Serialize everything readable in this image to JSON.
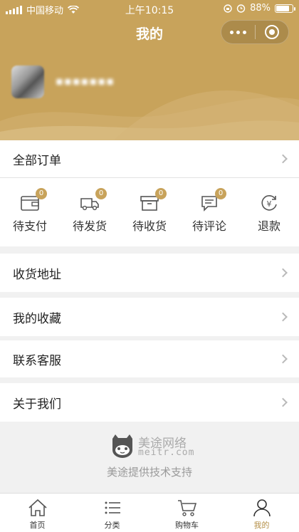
{
  "status_bar": {
    "carrier": "中国移动",
    "time": "上午10:15",
    "battery": "88%",
    "battery_level": 0.88
  },
  "nav": {
    "title": "我的"
  },
  "profile": {
    "username": "▪▪▪▪▪▪▪"
  },
  "orders": {
    "all_label": "全部订单",
    "items": [
      {
        "label": "待支付",
        "badge": "0",
        "icon": "wallet-icon"
      },
      {
        "label": "待发货",
        "badge": "0",
        "icon": "delivery-truck-icon"
      },
      {
        "label": "待收货",
        "badge": "0",
        "icon": "package-box-icon"
      },
      {
        "label": "待评论",
        "badge": "0",
        "icon": "comment-icon"
      },
      {
        "label": "退款",
        "badge": "",
        "icon": "yen-refund-icon"
      }
    ]
  },
  "menu": {
    "address": "收货地址",
    "favorites": "我的收藏",
    "contact": "联系客服",
    "about": "关于我们"
  },
  "brand": {
    "name": "美途网络",
    "url": "meitr.com",
    "support": "美途提供技术支持"
  },
  "tabbar": {
    "items": [
      {
        "label": "首页",
        "icon": "home-icon"
      },
      {
        "label": "分类",
        "icon": "list-icon"
      },
      {
        "label": "购物车",
        "icon": "cart-icon"
      },
      {
        "label": "我的",
        "icon": "user-icon"
      }
    ]
  },
  "colors": {
    "accent": "#c8a35b",
    "background": "#f1f1f1"
  }
}
